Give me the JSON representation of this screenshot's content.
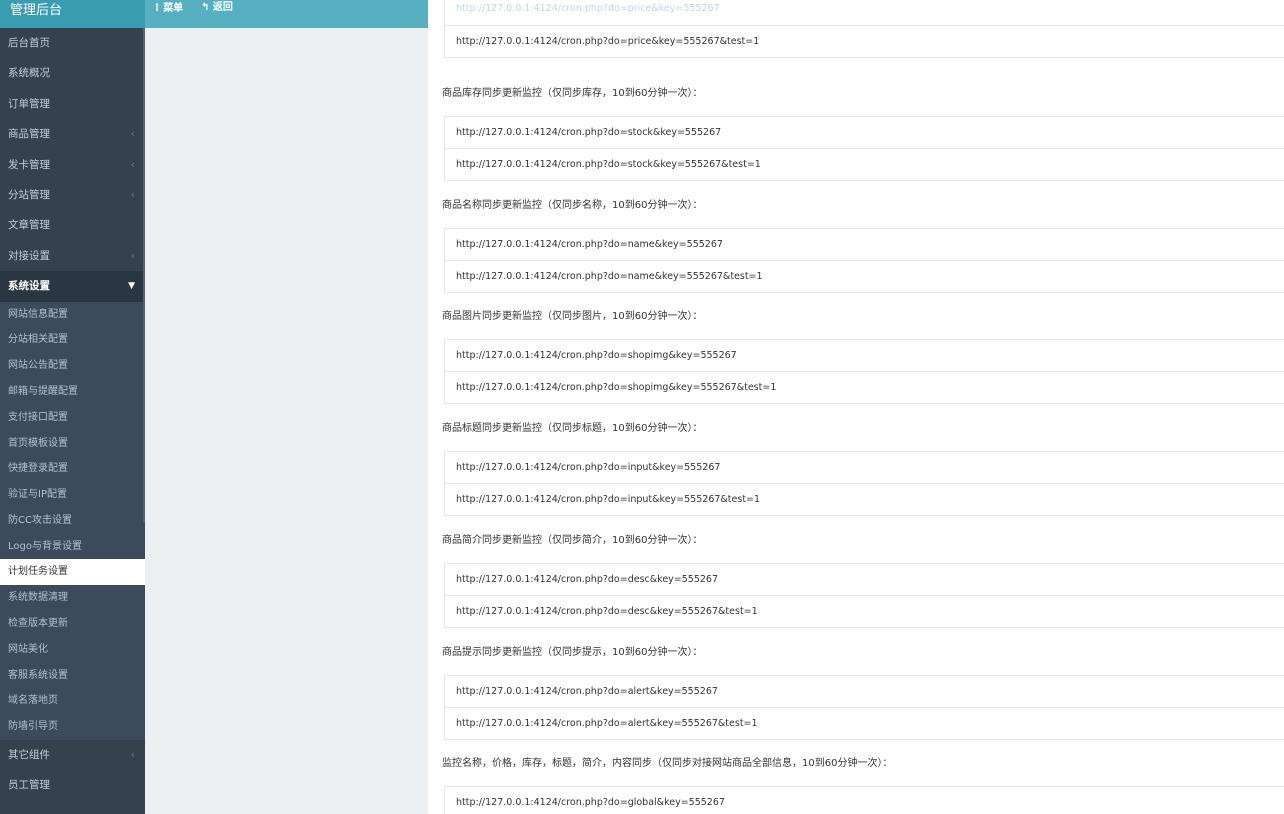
{
  "brand": "管理后台",
  "topbar": {
    "menu_label": "菜单",
    "back_label": "返回"
  },
  "sidebar": {
    "items_before": [
      {
        "label": "后台首页",
        "has_children": false
      },
      {
        "label": "系统概况",
        "has_children": false
      },
      {
        "label": "订单管理",
        "has_children": false
      },
      {
        "label": "商品管理",
        "has_children": true
      },
      {
        "label": "发卡管理",
        "has_children": true
      },
      {
        "label": "分站管理",
        "has_children": true
      },
      {
        "label": "文章管理",
        "has_children": false
      },
      {
        "label": "对接设置",
        "has_children": true
      }
    ],
    "open_item": "系统设置",
    "sub_items": [
      "网站信息配置",
      "分站相关配置",
      "网站公告配置",
      "邮箱与提醒配置",
      "支付接口配置",
      "首页模板设置",
      "快捷登录配置",
      "验证与IP配置",
      "防CC攻击设置",
      "Logo与背景设置",
      "计划任务设置",
      "系统数据清理",
      "检查版本更新",
      "网站美化",
      "客服系统设置",
      "域名落地页",
      "防墙引导页"
    ],
    "active_sub": "计划任务设置",
    "items_after": [
      {
        "label": "其它组件",
        "has_children": true
      },
      {
        "label": "员工管理",
        "has_children": false
      }
    ]
  },
  "content": {
    "first_partial_url": "http://127.0.0.1:4124/cron.php?do=price&key=555267",
    "first_test_url": "http://127.0.0.1:4124/cron.php?do=price&key=555267&test=1",
    "sections": [
      {
        "label": "商品库存同步更新监控（仅同步库存，10到60分钟一次）：",
        "urls": [
          "http://127.0.0.1:4124/cron.php?do=stock&key=555267",
          "http://127.0.0.1:4124/cron.php?do=stock&key=555267&test=1"
        ]
      },
      {
        "label": "商品名称同步更新监控（仅同步名称，10到60分钟一次）：",
        "urls": [
          "http://127.0.0.1:4124/cron.php?do=name&key=555267",
          "http://127.0.0.1:4124/cron.php?do=name&key=555267&test=1"
        ]
      },
      {
        "label": "商品图片同步更新监控（仅同步图片，10到60分钟一次）：",
        "urls": [
          "http://127.0.0.1:4124/cron.php?do=shopimg&key=555267",
          "http://127.0.0.1:4124/cron.php?do=shopimg&key=555267&test=1"
        ]
      },
      {
        "label": "商品标题同步更新监控（仅同步标题，10到60分钟一次）：",
        "urls": [
          "http://127.0.0.1:4124/cron.php?do=input&key=555267",
          "http://127.0.0.1:4124/cron.php?do=input&key=555267&test=1"
        ]
      },
      {
        "label": "商品简介同步更新监控（仅同步简介，10到60分钟一次）：",
        "urls": [
          "http://127.0.0.1:4124/cron.php?do=desc&key=555267",
          "http://127.0.0.1:4124/cron.php?do=desc&key=555267&test=1"
        ]
      },
      {
        "label": "商品提示同步更新监控（仅同步提示，10到60分钟一次）：",
        "urls": [
          "http://127.0.0.1:4124/cron.php?do=alert&key=555267",
          "http://127.0.0.1:4124/cron.php?do=alert&key=555267&test=1"
        ]
      },
      {
        "label": "监控名称，价格，库存，标题，简介，内容同步（仅同步对接网站商品全部信息，10到60分钟一次）：",
        "urls": [
          "http://127.0.0.1:4124/cron.php?do=global&key=555267"
        ]
      }
    ]
  }
}
